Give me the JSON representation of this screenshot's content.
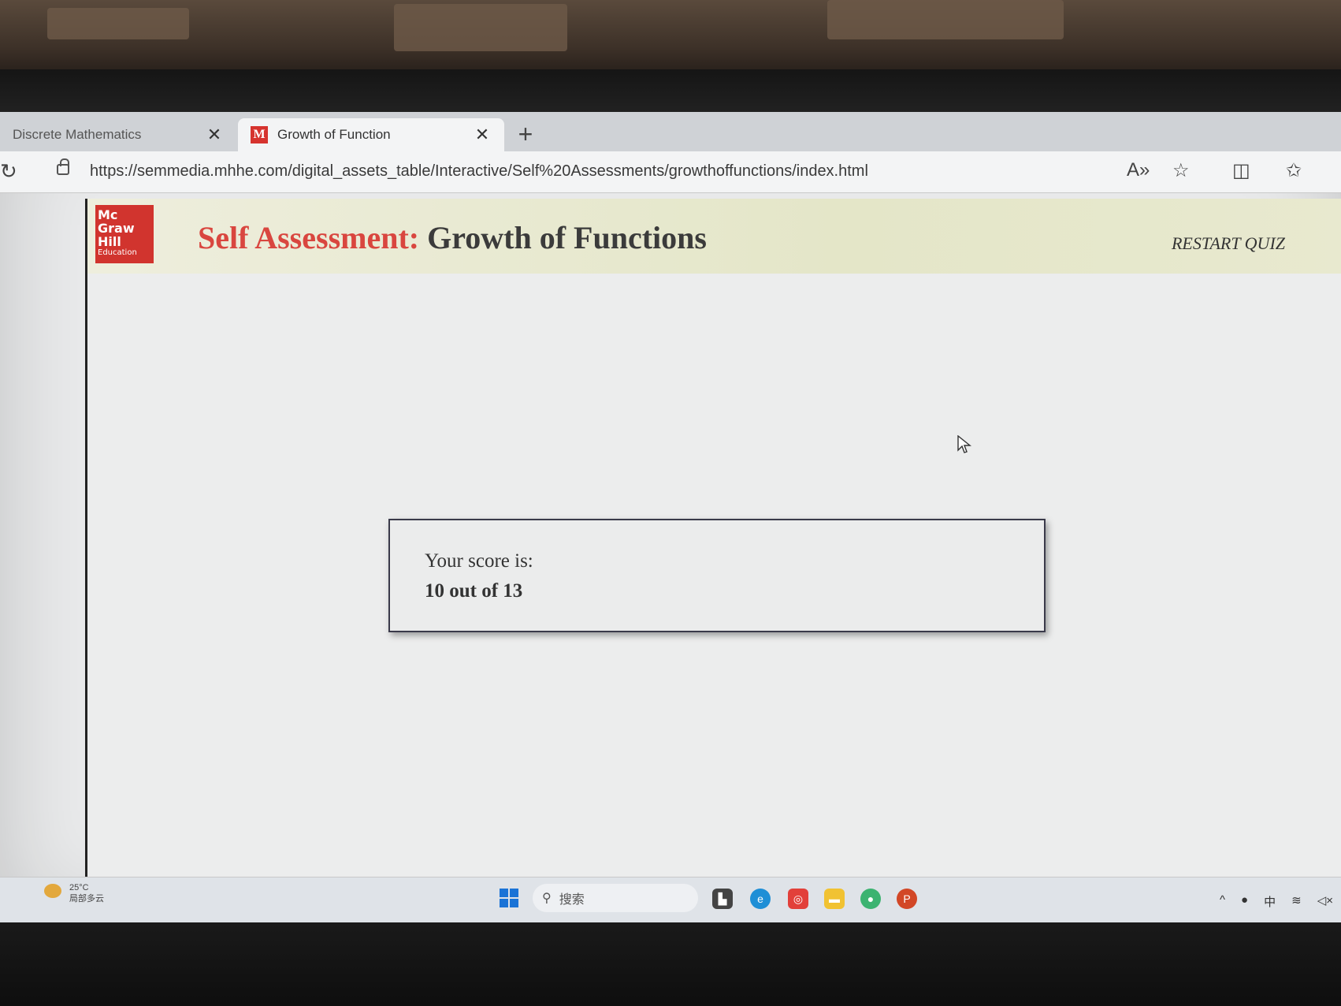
{
  "browser": {
    "tabs": [
      {
        "label": "Discrete Mathematics",
        "active": false
      },
      {
        "label": "Growth of Function",
        "active": true,
        "favicon": "M"
      }
    ],
    "new_tab_label": "+",
    "address": "https://semmedia.mhhe.com/digital_assets_table/Interactive/Self%20Assessments/growthoffunctions/index.html",
    "toolbar_icons": [
      "reload-icon",
      "lock-icon",
      "read-aloud-icon",
      "add-favorite-icon",
      "split-screen-icon",
      "favorites-icon"
    ]
  },
  "page": {
    "logo": {
      "line1": "Mc",
      "line2": "Graw",
      "line3": "Hill",
      "line4": "Education"
    },
    "title_prefix": "Self Assessment:",
    "title_main": "Growth of Functions",
    "restart_label": "RESTART QUIZ",
    "score": {
      "label": "Your score is:",
      "value": "10 out of 13"
    },
    "colors": {
      "title_red": "#d9463f",
      "logo_red": "#d1342e",
      "banner": "#e4e6c8"
    }
  },
  "taskbar": {
    "weather_temp": "25°C",
    "weather_desc": "局部多云",
    "search_placeholder": "搜索",
    "tray_ime": "中"
  }
}
